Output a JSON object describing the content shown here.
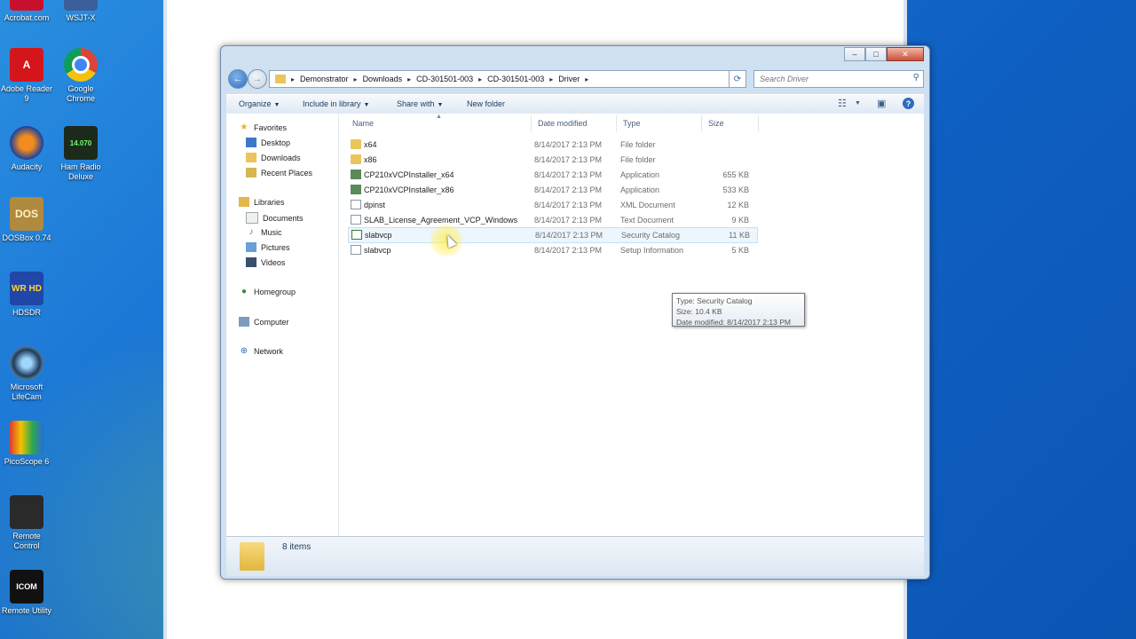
{
  "desktop": {
    "icons": [
      {
        "label": "Acrobat.com"
      },
      {
        "label": "WSJT-X"
      },
      {
        "label": "Adobe Reader 9"
      },
      {
        "label": "Google Chrome"
      },
      {
        "label": "Audacity"
      },
      {
        "label": "Ham Radio Deluxe"
      },
      {
        "label": "DOSBox 0.74"
      },
      {
        "label": "HDSDR"
      },
      {
        "label": "Microsoft LifeCam"
      },
      {
        "label": "PicoScope 6"
      },
      {
        "label": "Remote Control"
      },
      {
        "label": "Remote Utility"
      }
    ],
    "glyph_text": {
      "adobe": "A",
      "hrd": "14.070",
      "dosbox": "DOS",
      "hdsdr": "WR HD",
      "icom": "ICOM"
    }
  },
  "window": {
    "breadcrumbs": [
      "Demonstrator",
      "Downloads",
      "CD-301501-003",
      "CD-301501-003",
      "Driver"
    ],
    "search_placeholder": "Search Driver",
    "toolbar": {
      "organize": "Organize",
      "include_in_library": "Include in library",
      "share_with": "Share with",
      "new_folder": "New folder"
    },
    "nav_pane": {
      "favorites": "Favorites",
      "desktop": "Desktop",
      "downloads": "Downloads",
      "recent_places": "Recent Places",
      "libraries": "Libraries",
      "documents": "Documents",
      "music": "Music",
      "pictures": "Pictures",
      "videos": "Videos",
      "homegroup": "Homegroup",
      "computer": "Computer",
      "network": "Network"
    },
    "columns": {
      "name": "Name",
      "date_modified": "Date modified",
      "type": "Type",
      "size": "Size"
    },
    "files": [
      {
        "name": "x64",
        "date": "8/14/2017 2:13 PM",
        "type": "File folder",
        "size": ""
      },
      {
        "name": "x86",
        "date": "8/14/2017 2:13 PM",
        "type": "File folder",
        "size": ""
      },
      {
        "name": "CP210xVCPInstaller_x64",
        "date": "8/14/2017 2:13 PM",
        "type": "Application",
        "size": "655 KB"
      },
      {
        "name": "CP210xVCPInstaller_x86",
        "date": "8/14/2017 2:13 PM",
        "type": "Application",
        "size": "533 KB"
      },
      {
        "name": "dpinst",
        "date": "8/14/2017 2:13 PM",
        "type": "XML Document",
        "size": "12 KB"
      },
      {
        "name": "SLAB_License_Agreement_VCP_Windows",
        "date": "8/14/2017 2:13 PM",
        "type": "Text Document",
        "size": "9 KB"
      },
      {
        "name": "slabvcp",
        "date": "8/14/2017 2:13 PM",
        "type": "Security Catalog",
        "size": "11 KB"
      },
      {
        "name": "slabvcp",
        "date": "8/14/2017 2:13 PM",
        "type": "Setup Information",
        "size": "5 KB"
      }
    ],
    "tooltip": {
      "type_line": "Type: Security Catalog",
      "size_line": "Size: 10.4 KB",
      "date_line": "Date modified: 8/14/2017 2:13 PM"
    },
    "status": {
      "item_count": "8 items"
    }
  }
}
